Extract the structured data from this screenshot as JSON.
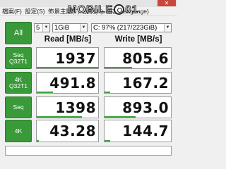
{
  "window": {
    "close_symbol": "✕"
  },
  "menu": {
    "items": [
      "檔案(F)",
      "設定(S)",
      "佈景主題(T)",
      "說明(H)",
      "語言(Language)"
    ]
  },
  "watermark": {
    "part1": "MOBIL",
    "part2": "E",
    "part3": "01"
  },
  "toolbar": {
    "all_label": "All",
    "count_value": "5",
    "size_value": "1GiB",
    "drive_value": "C: 97% (217/223GiB)"
  },
  "headers": {
    "read": "Read [MB/s]",
    "write": "Write [MB/s]"
  },
  "rows": [
    {
      "label_line1": "Seq",
      "label_line2": "Q32T1",
      "read": "1937",
      "write": "805.6",
      "read_fill": 1.0,
      "write_fill": 0.42
    },
    {
      "label_line1": "4K",
      "label_line2": "Q32T1",
      "read": "491.8",
      "write": "167.2",
      "read_fill": 0.26,
      "write_fill": 0.09
    },
    {
      "label_line1": "Seq",
      "label_line2": "",
      "read": "1398",
      "write": "893.0",
      "read_fill": 0.73,
      "write_fill": 0.47
    },
    {
      "label_line1": "4K",
      "label_line2": "",
      "read": "43.28",
      "write": "144.7",
      "read_fill": 0.03,
      "write_fill": 0.08
    }
  ],
  "colors": {
    "accent_green": "#3a9a3a",
    "bar_green": "#3ca63c"
  },
  "status": {
    "text": ""
  }
}
